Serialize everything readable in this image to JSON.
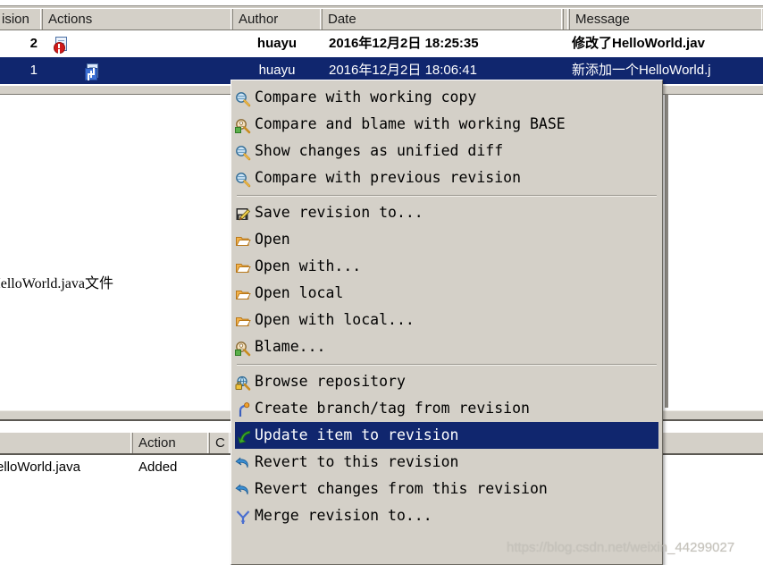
{
  "log_list": {
    "columns": [
      {
        "label": "ision",
        "name": "revision"
      },
      {
        "label": "Actions",
        "name": "actions"
      },
      {
        "label": "Author",
        "name": "author"
      },
      {
        "label": "Date",
        "name": "date"
      },
      {
        "label": "",
        "name": "spacer"
      },
      {
        "label": "Message",
        "name": "message"
      }
    ],
    "rows": [
      {
        "revision": "2",
        "action_icon": "modified-file-icon",
        "author": "huayu",
        "date": "2016年12月2日 18:25:35",
        "message": "修改了HelloWorld.jav",
        "selected": false
      },
      {
        "revision": "1",
        "action_icon": "added-file-icon",
        "author": "huayu",
        "date": "2016年12月2日 18:06:41",
        "message": "新添加一个HelloWorld.j",
        "selected": true
      }
    ]
  },
  "message_detail": {
    "text": "|一个HelloWorld.java文件"
  },
  "changed_paths": {
    "columns": [
      {
        "label": "",
        "name": "path"
      },
      {
        "label": "Action",
        "name": "action"
      },
      {
        "label": "C",
        "name": "copyfrom"
      }
    ],
    "rows": [
      {
        "path": "elloWorld.java",
        "action": "Added",
        "copyfrom": ""
      }
    ]
  },
  "context_menu": {
    "items": [
      {
        "type": "item",
        "label": "Compare with working copy",
        "icon": "compare-magnifier-icon",
        "selected": false
      },
      {
        "type": "item",
        "label": "Compare and blame with working BASE",
        "icon": "blame-magnifier-icon",
        "selected": false
      },
      {
        "type": "item",
        "label": "Show changes as unified diff",
        "icon": "compare-magnifier-icon",
        "selected": false
      },
      {
        "type": "item",
        "label": "Compare with previous revision",
        "icon": "compare-magnifier-icon",
        "selected": false
      },
      {
        "type": "separator"
      },
      {
        "type": "item",
        "label": "Save revision to...",
        "icon": "save-pencil-icon",
        "selected": false
      },
      {
        "type": "item",
        "label": "Open",
        "icon": "open-folder-icon",
        "selected": false
      },
      {
        "type": "item",
        "label": "Open with...",
        "icon": "open-folder-icon",
        "selected": false
      },
      {
        "type": "item",
        "label": "Open local",
        "icon": "open-folder-icon",
        "selected": false
      },
      {
        "type": "item",
        "label": "Open with local...",
        "icon": "open-folder-icon",
        "selected": false
      },
      {
        "type": "item",
        "label": "Blame...",
        "icon": "blame-magnifier-icon",
        "selected": false
      },
      {
        "type": "separator"
      },
      {
        "type": "item",
        "label": "Browse repository",
        "icon": "browse-repository-icon",
        "selected": false
      },
      {
        "type": "item",
        "label": "Create branch/tag from revision",
        "icon": "branch-tag-icon",
        "selected": false
      },
      {
        "type": "item",
        "label": "Update item to revision",
        "icon": "update-arrow-icon",
        "selected": true
      },
      {
        "type": "item",
        "label": "Revert to this revision",
        "icon": "revert-arrow-icon",
        "selected": false
      },
      {
        "type": "item",
        "label": "Revert changes from this revision",
        "icon": "revert-arrow-icon",
        "selected": false
      },
      {
        "type": "item",
        "label": "Merge revision to...",
        "icon": "merge-icon",
        "selected": false
      }
    ]
  },
  "watermark": {
    "text": "https://blog.csdn.net/weixin_44299027"
  },
  "colors": {
    "selection_blue": "#10266e",
    "menu_bg": "#d4d0c8",
    "header_bg": "#d4d0c8"
  }
}
